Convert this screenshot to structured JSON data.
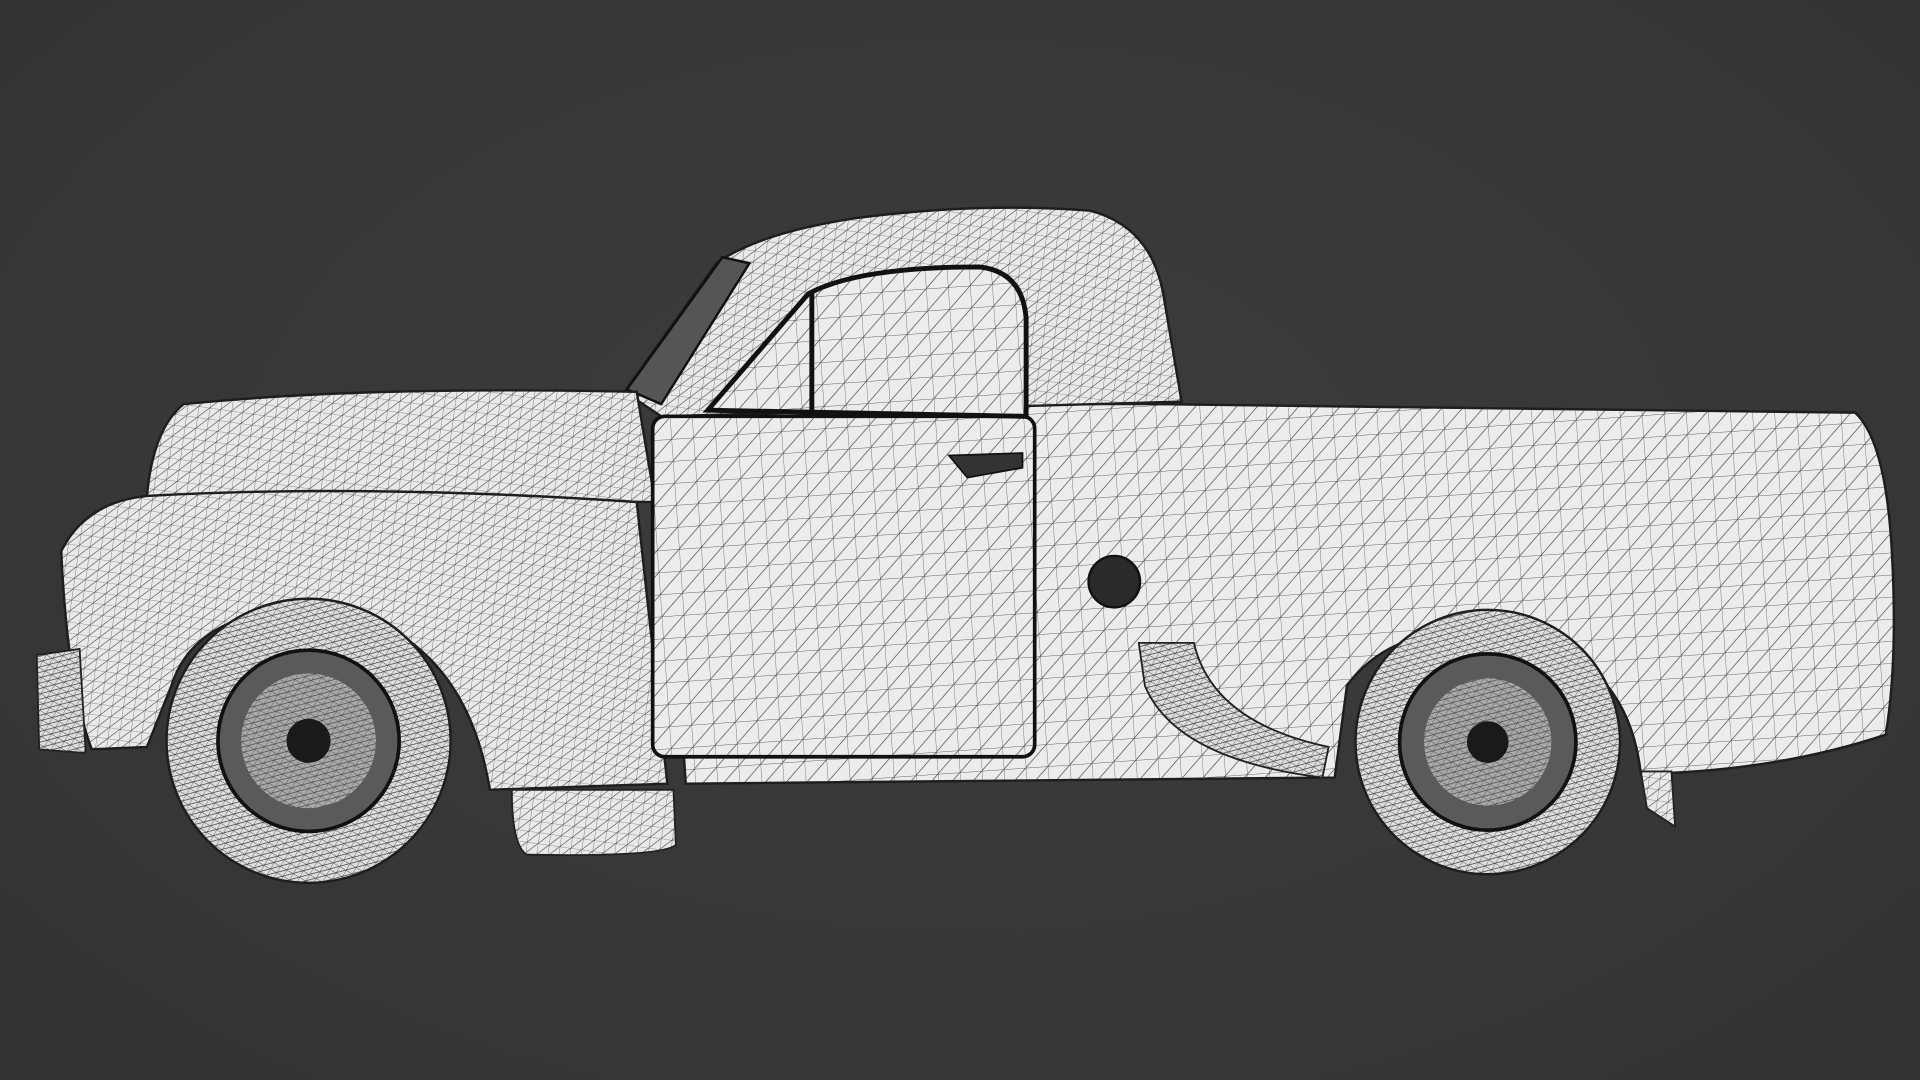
{
  "scene": {
    "subject": "wireframe-ute-model",
    "background_color": "#383838",
    "mesh_color": "#e9e9e9",
    "wire_color": "#1e1e1e"
  }
}
